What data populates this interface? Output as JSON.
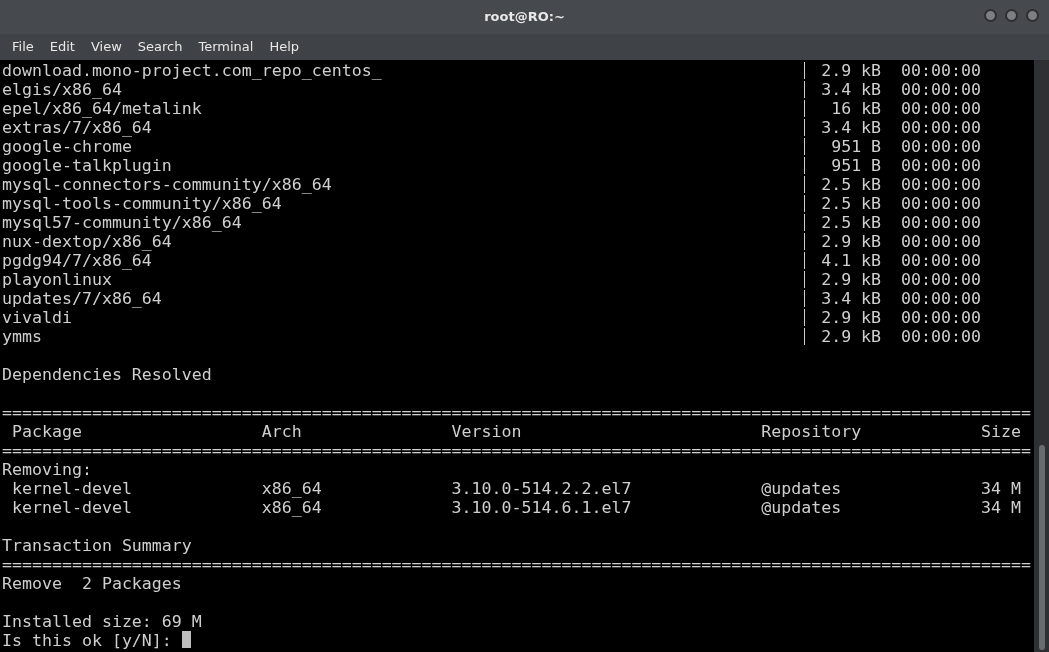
{
  "window": {
    "title": "root@RO:~"
  },
  "menu": [
    "File",
    "Edit",
    "View",
    "Search",
    "Terminal",
    "Help"
  ],
  "repos": [
    {
      "name": "download.mono-project.com_repo_centos_",
      "size": "2.9 kB",
      "time": "00:00:00"
    },
    {
      "name": "elgis/x86_64",
      "size": "3.4 kB",
      "time": "00:00:00"
    },
    {
      "name": "epel/x86_64/metalink",
      "size": "16 kB",
      "time": "00:00:00"
    },
    {
      "name": "extras/7/x86_64",
      "size": "3.4 kB",
      "time": "00:00:00"
    },
    {
      "name": "google-chrome",
      "size": "951 B",
      "time": "00:00:00"
    },
    {
      "name": "google-talkplugin",
      "size": "951 B",
      "time": "00:00:00"
    },
    {
      "name": "mysql-connectors-community/x86_64",
      "size": "2.5 kB",
      "time": "00:00:00"
    },
    {
      "name": "mysql-tools-community/x86_64",
      "size": "2.5 kB",
      "time": "00:00:00"
    },
    {
      "name": "mysql57-community/x86_64",
      "size": "2.5 kB",
      "time": "00:00:00"
    },
    {
      "name": "nux-dextop/x86_64",
      "size": "2.9 kB",
      "time": "00:00:00"
    },
    {
      "name": "pgdg94/7/x86_64",
      "size": "4.1 kB",
      "time": "00:00:00"
    },
    {
      "name": "playonlinux",
      "size": "2.9 kB",
      "time": "00:00:00"
    },
    {
      "name": "updates/7/x86_64",
      "size": "3.4 kB",
      "time": "00:00:00"
    },
    {
      "name": "vivaldi",
      "size": "2.9 kB",
      "time": "00:00:00"
    },
    {
      "name": "ymms",
      "size": "2.9 kB",
      "time": "00:00:00"
    }
  ],
  "dependencies_heading": "Dependencies Resolved",
  "table": {
    "rule_top": "=======================================================================================================",
    "columns": [
      "Package",
      "Arch",
      "Version",
      "Repository",
      "Size"
    ],
    "rule_header": "=======================================================================================================",
    "section": "Removing:",
    "rows": [
      [
        "kernel-devel",
        "x86_64",
        "3.10.0-514.2.2.el7",
        "@updates",
        "34 M"
      ],
      [
        "kernel-devel",
        "x86_64",
        "3.10.0-514.6.1.el7",
        "@updates",
        "34 M"
      ]
    ]
  },
  "summary": {
    "heading": "Transaction Summary",
    "rule": "=======================================================================================================",
    "line": "Remove  2 Packages"
  },
  "installed_size": "Installed size: 69 M",
  "prompt": "Is this ok [y/N]:"
}
